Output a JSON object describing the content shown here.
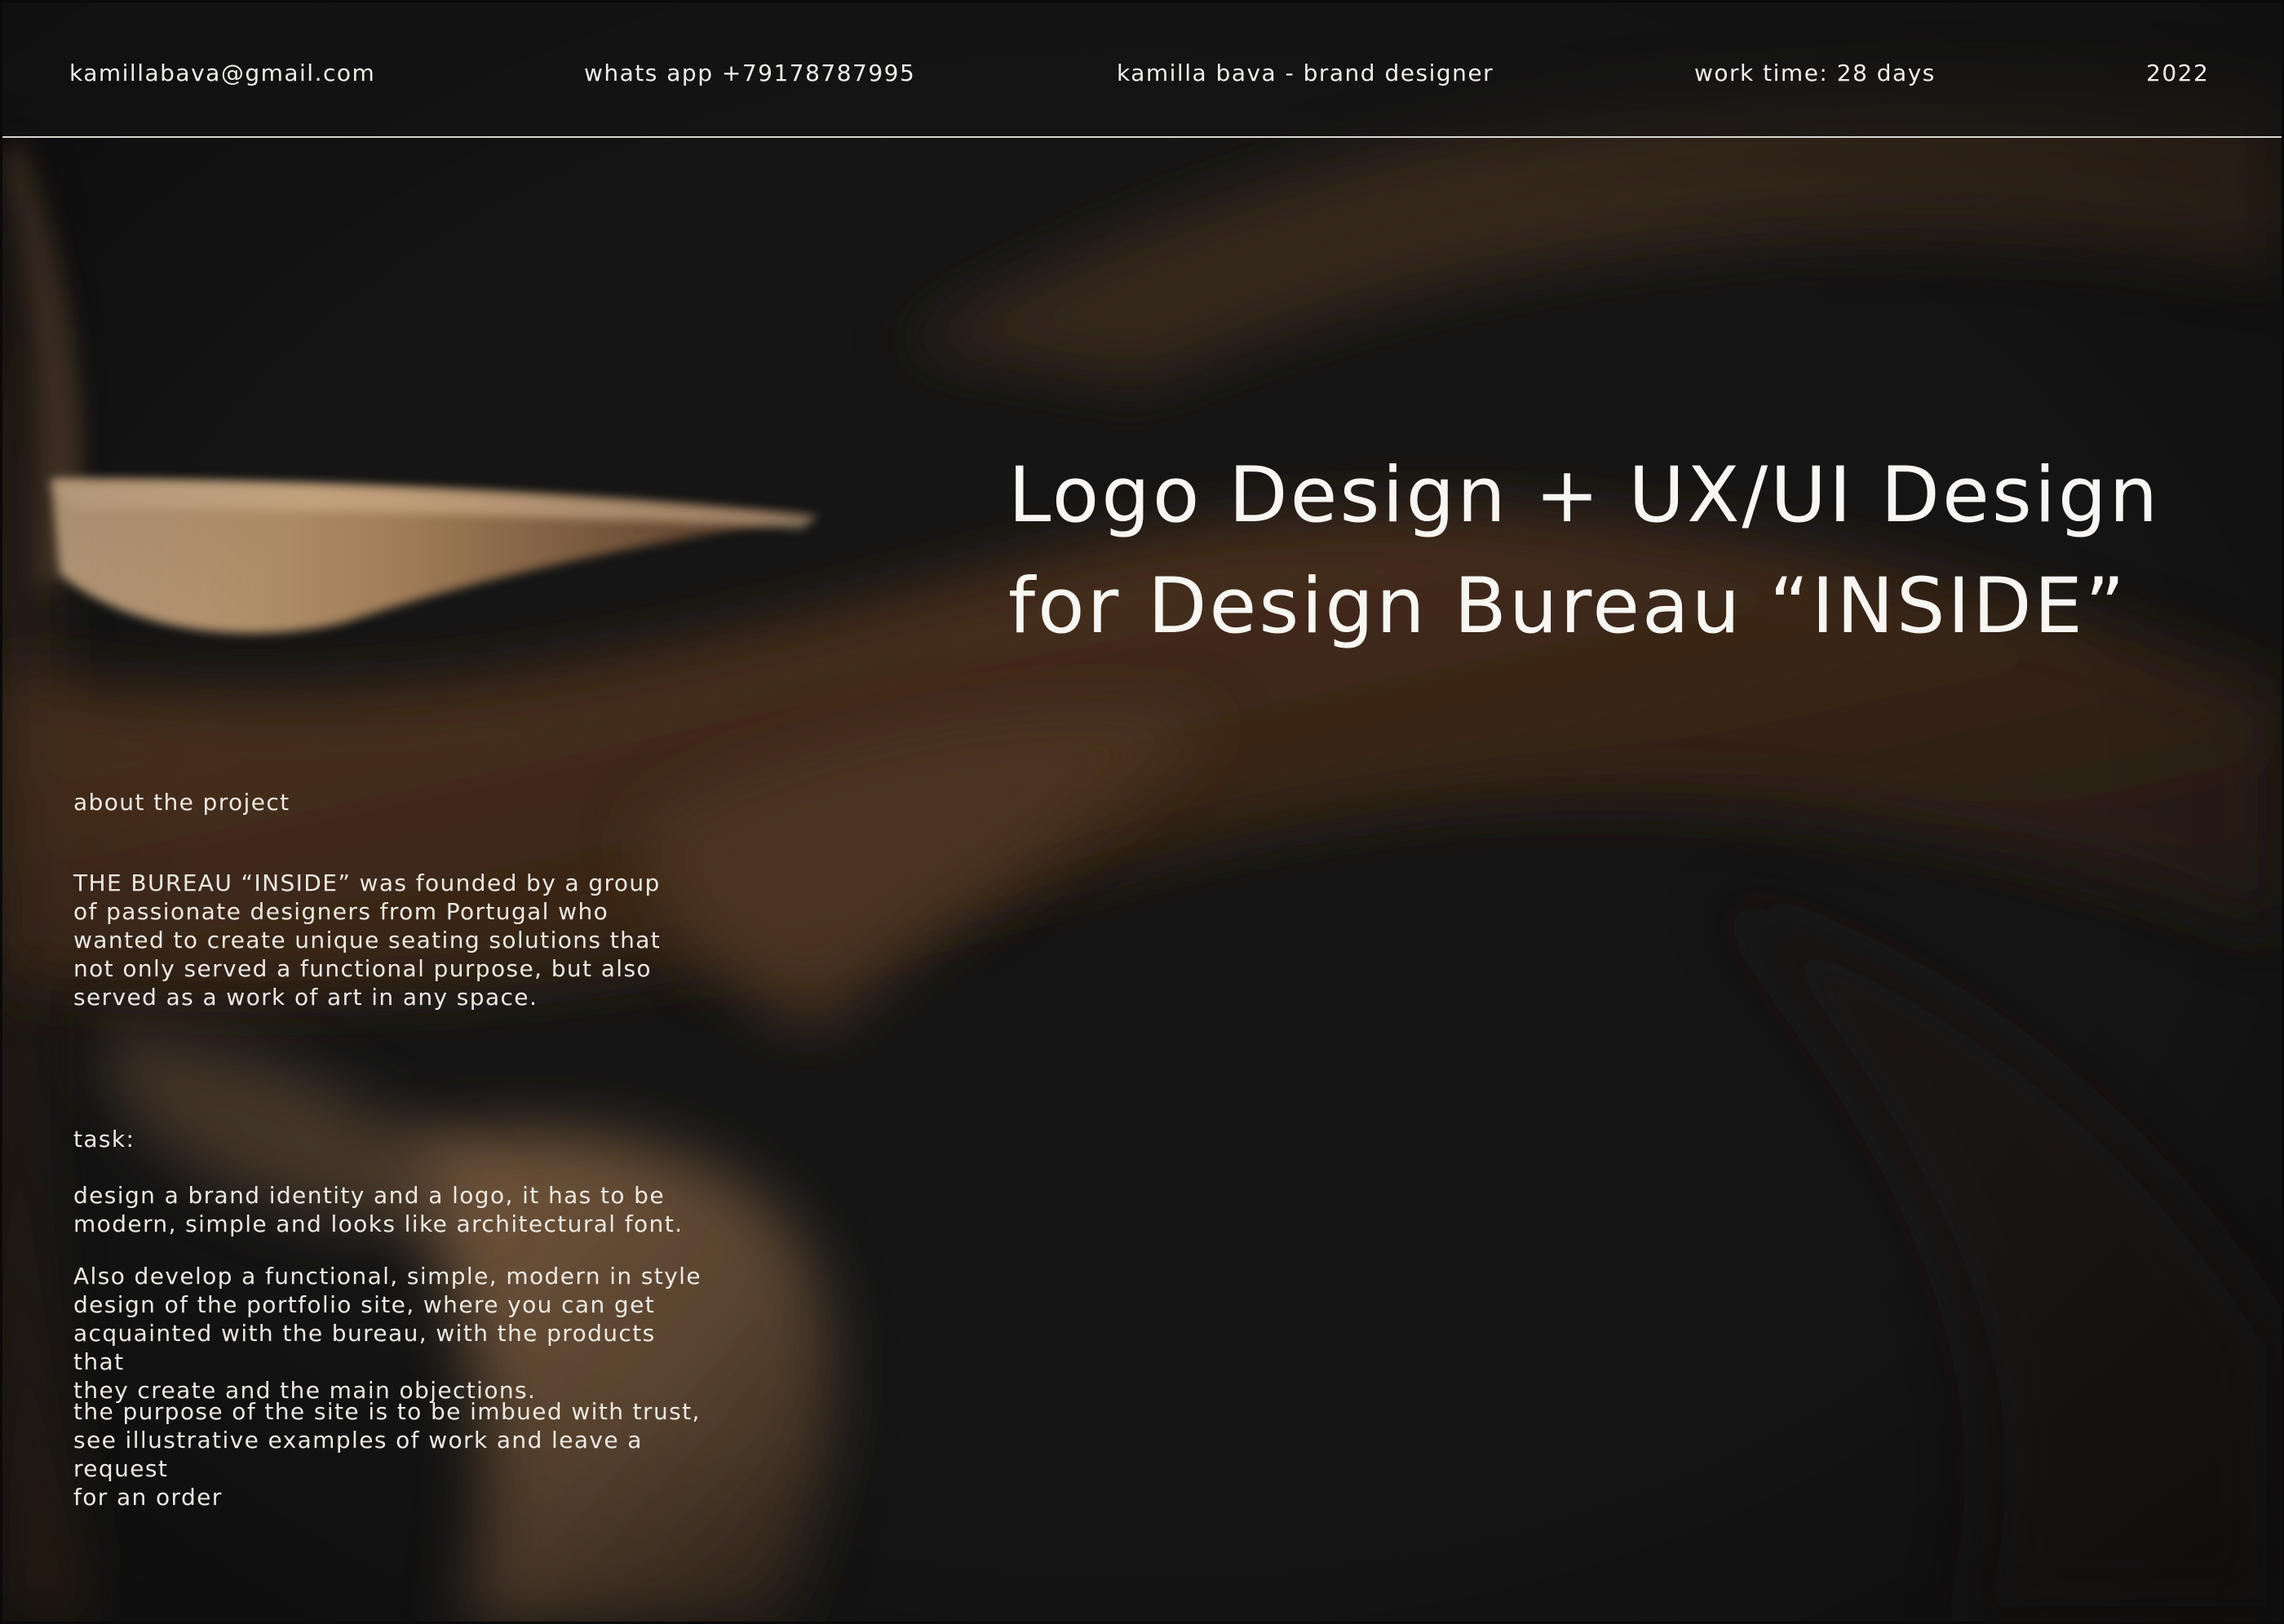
{
  "header": {
    "email": "kamillabava@gmail.com",
    "phone": "whats app +79178787995",
    "name": "kamilla bava - brand designer",
    "work_time": "work time: 28 days",
    "year": "2022"
  },
  "title": {
    "line1": "Logo Design + UX/UI Design",
    "line2": "for Design Bureau  “INSIDE”"
  },
  "about": {
    "label": "about the project",
    "body": "THE BUREAU “INSIDE” was founded by a group\nof passionate designers from Portugal who\nwanted to create unique seating solutions that\nnot only served a functional purpose, but also\nserved as a work of art in any space."
  },
  "task": {
    "label": "task:",
    "p1": "design a brand identity and a logo, it has to be\nmodern, simple and looks like architectural font.",
    "p2": "Also develop a functional, simple, modern in style\ndesign of the portfolio site, where you can get\nacquainted with the bureau, with the products that\nthey create and  the main objections.",
    "p3": "the purpose of the site is to be imbued with trust,\nsee illustrative examples of work and leave a request\nfor an order"
  },
  "background": {
    "description_colors": {
      "base": "#151515",
      "wood_light": "#b89a78",
      "wood_mid": "#6e4a30",
      "wood_dark": "#3a2618"
    }
  }
}
